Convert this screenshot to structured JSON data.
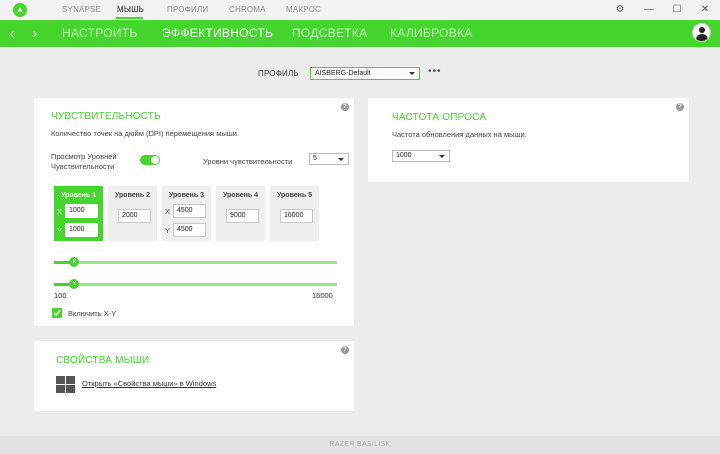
{
  "colors": {
    "accent": "#44d62c",
    "accent_light": "#9be48d"
  },
  "titlebar": {
    "tabs": [
      {
        "label": "SYNAPSE"
      },
      {
        "label": "МЫШЬ"
      },
      {
        "label": "ПРОФИЛИ"
      },
      {
        "label": "CHROMA"
      },
      {
        "label": "МАКРОС"
      }
    ],
    "active_tab": "МЫШЬ",
    "settings_icon": "gear-icon",
    "minimize_icon": "minimize-icon",
    "maximize_icon": "maximize-icon",
    "close_icon": "close-icon"
  },
  "nav": {
    "tabs": [
      {
        "label": "НАСТРОИТЬ"
      },
      {
        "label": "ЭФФЕКТИВНОСТЬ"
      },
      {
        "label": "ПОДСВЕТКА"
      },
      {
        "label": "КАЛИБРОВКА"
      }
    ],
    "active_tab": "ЭФФЕКТИВНОСТЬ"
  },
  "profile": {
    "label": "ПРОФИЛЬ",
    "value": "AISBERG-Default",
    "more": "•••"
  },
  "sensitivity": {
    "title": "ЧУВСТВИТЕЛЬНОСТЬ",
    "description": "Количество точек на дюйм (DPI) перемещения мыши.",
    "stages_toggle_line1": "Просмотр Уровней",
    "stages_toggle_line2": "Чувствительности",
    "stages_toggle_on": true,
    "levels_label": "Уровни чувствительности",
    "levels_value": "5",
    "stages": [
      {
        "label": "Уровень 1",
        "x": "1000",
        "y": "1000"
      },
      {
        "label": "Уровень 2",
        "value": "2000"
      },
      {
        "label": "Уровень 3",
        "x": "4500",
        "y": "4500"
      },
      {
        "label": "Уровень 4",
        "value": "9000"
      },
      {
        "label": "Уровень 5",
        "value": "16000"
      }
    ],
    "active_stage": 1,
    "axis_x": "X",
    "axis_y": "Y",
    "slider_x_value": 1000,
    "slider_y_value": 1000,
    "range_min": "100",
    "range_max": "16000",
    "enable_xy_label": "Включить X-Y",
    "enable_xy_checked": true
  },
  "polling": {
    "title": "ЧАСТОТА ОПРОСА",
    "description": "Частота обновления данных на мыши.",
    "value": "1000"
  },
  "mouse_props": {
    "title": "СВОЙСТВА МЫШИ",
    "link": "Открыть «Свойства мыши» в Windows",
    "icon": "windows-icon"
  },
  "help": "?",
  "footer": {
    "device": "RAZER BASILISK"
  }
}
